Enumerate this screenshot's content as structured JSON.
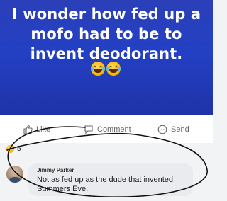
{
  "post": {
    "text": "I wonder how fed up a mofo had to be to invent deodorant.",
    "emojis": [
      "face-with-tears-of-joy-icon",
      "face-with-tears-of-joy-icon"
    ],
    "background_color": "#2340c4",
    "text_color": "#ffffff"
  },
  "actions": {
    "like_label": "Like",
    "comment_label": "Comment",
    "send_label": "Send"
  },
  "reactions": {
    "count": "5",
    "icon": "laughing-reaction-icon"
  },
  "comment": {
    "author": "Jimmy Parker",
    "text": "Not as fed up as the dude that invented Summers Eve."
  },
  "annotation": {
    "stroke_color": "#111111"
  }
}
